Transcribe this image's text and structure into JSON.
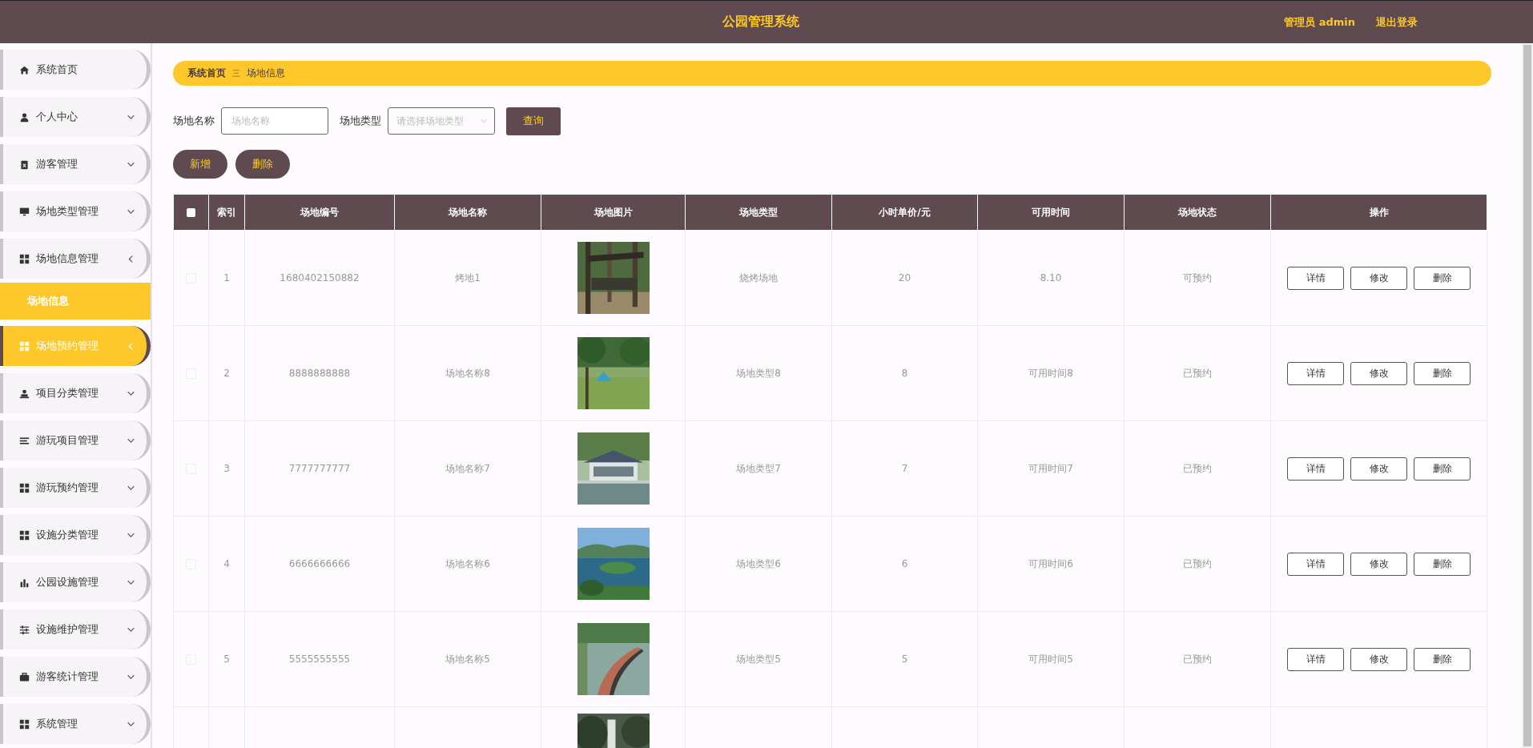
{
  "header": {
    "title": "公园管理系统",
    "user": "管理员 admin",
    "logout": "退出登录"
  },
  "sidebar": {
    "items": [
      {
        "label": "系统首页",
        "highlighted": false
      },
      {
        "label": "个人中心",
        "expanded": false,
        "highlighted": false
      },
      {
        "label": "游客管理",
        "expanded": false,
        "highlighted": false
      },
      {
        "label": "场地类型管理",
        "expanded": false,
        "highlighted": false
      },
      {
        "label": "场地信息管理",
        "expanded": true,
        "highlighted": false,
        "children": [
          {
            "label": "场地信息",
            "selected": true
          }
        ]
      },
      {
        "label": "场地预约管理",
        "expanded": true,
        "highlighted": true
      },
      {
        "label": "项目分类管理",
        "expanded": false,
        "highlighted": false
      },
      {
        "label": "游玩项目管理",
        "expanded": false,
        "highlighted": false
      },
      {
        "label": "游玩预约管理",
        "expanded": false,
        "highlighted": false
      },
      {
        "label": "设施分类管理",
        "expanded": false,
        "highlighted": false
      },
      {
        "label": "公园设施管理",
        "expanded": false,
        "highlighted": false
      },
      {
        "label": "设施维护管理",
        "expanded": false,
        "highlighted": false
      },
      {
        "label": "游客统计管理",
        "expanded": false,
        "highlighted": false
      },
      {
        "label": "系统管理",
        "expanded": false,
        "highlighted": false
      }
    ]
  },
  "breadcrumb": {
    "home": "系统首页",
    "separator": "三",
    "current": "场地信息"
  },
  "search": {
    "name_label": "场地名称",
    "name_placeholder": "场地名称",
    "type_label": "场地类型",
    "type_placeholder": "请选择场地类型",
    "query_button": "查询"
  },
  "actions": [
    "新增",
    "删除"
  ],
  "table": {
    "select_all_checked": false,
    "columns": [
      "索引",
      "场地编号",
      "场地名称",
      "场地图片",
      "场地类型",
      "小时单价/元",
      "可用时间",
      "场地状态",
      "操作"
    ],
    "rows": [
      {
        "checked": false,
        "index": "1",
        "code": "1680402150882",
        "name": "烤地1",
        "type": "烧烤场地",
        "price": "20",
        "time": "8.10",
        "status": "可预约",
        "buttons": [
          "详情",
          "修改",
          "删除"
        ]
      },
      {
        "checked": false,
        "index": "2",
        "code": "8888888888",
        "name": "场地名称8",
        "type": "场地类型8",
        "price": "8",
        "time": "可用时间8",
        "status": "已预约",
        "buttons": [
          "详情",
          "修改",
          "删除"
        ]
      },
      {
        "checked": false,
        "index": "3",
        "code": "7777777777",
        "name": "场地名称7",
        "type": "场地类型7",
        "price": "7",
        "time": "可用时间7",
        "status": "已预约",
        "buttons": [
          "详情",
          "修改",
          "删除"
        ]
      },
      {
        "checked": false,
        "index": "4",
        "code": "6666666666",
        "name": "场地名称6",
        "type": "场地类型6",
        "price": "6",
        "time": "可用时间6",
        "status": "已预约",
        "buttons": [
          "详情",
          "修改",
          "删除"
        ]
      },
      {
        "checked": false,
        "index": "5",
        "code": "5555555555",
        "name": "场地名称5",
        "type": "场地类型5",
        "price": "5",
        "time": "可用时间5",
        "status": "已预约",
        "buttons": [
          "详情",
          "修改",
          "删除"
        ]
      }
    ]
  }
}
